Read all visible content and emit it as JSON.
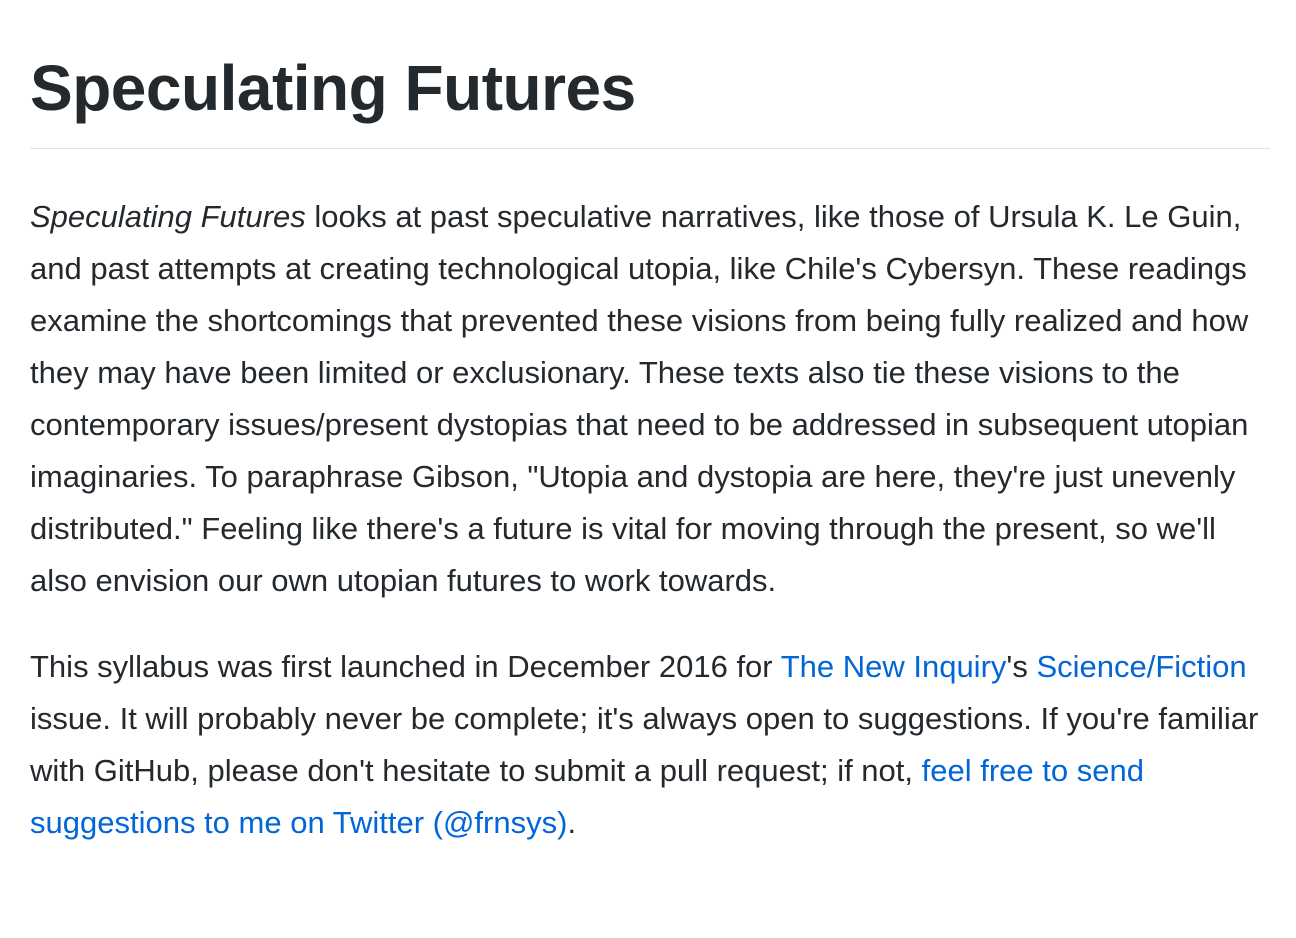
{
  "header": {
    "title": "Speculating Futures"
  },
  "intro": {
    "em": "Speculating Futures",
    "text": " looks at past speculative narratives, like those of Ursula K. Le Guin, and past attempts at creating technological utopia, like Chile's Cybersyn. These readings examine the shortcomings that prevented these visions from being fully realized and how they may have been limited or exclusionary. These texts also tie these visions to the contemporary issues/present dystopias that need to be addressed in subsequent utopian imaginaries. To paraphrase Gibson, \"Utopia and dystopia are here, they're just unevenly distributed.\" Feeling like there's a future is vital for moving through the present, so we'll also envision our own utopian futures to work towards."
  },
  "about": {
    "text_1": "This syllabus was first launched in December 2016 for ",
    "link_new_inquiry": "The New Inquiry",
    "text_2": "'s ",
    "link_science_fiction": "Science/Fiction",
    "text_3": " issue. It will probably never be complete; it's always open to suggestions. If you're familiar with GitHub, please don't hesitate to submit a pull request; if not, ",
    "link_twitter": "feel free to send suggestions to me on Twitter (@frnsys)",
    "text_4": "."
  },
  "colors": {
    "text": "#24292e",
    "link": "#0366d6",
    "rule": "#dfe2e5"
  }
}
